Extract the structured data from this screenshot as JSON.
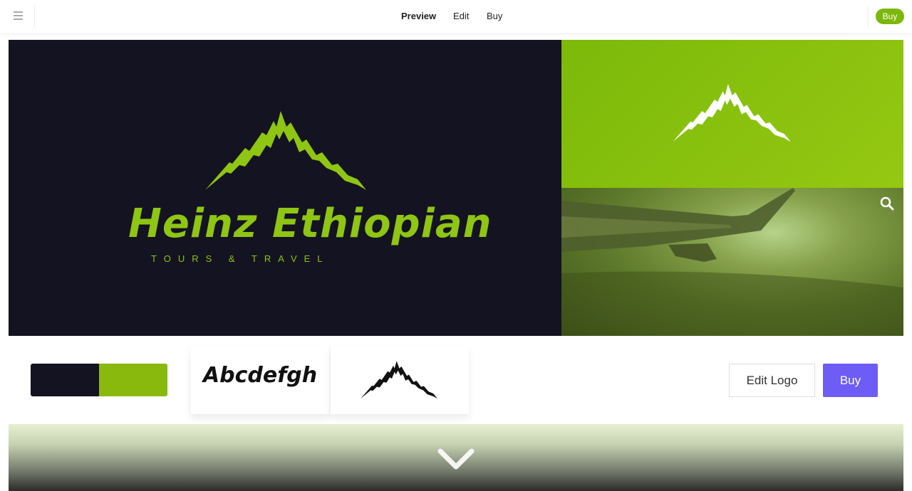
{
  "topbar": {
    "menu_icon": "hamburger-menu-icon",
    "nav": [
      "Preview",
      "Edit",
      "Buy"
    ],
    "active_tab": "Preview",
    "buy_label": "Buy",
    "buy_color": "#7cb809"
  },
  "hero": {
    "brand_name": "Heinz Ethiopian",
    "brand_tagline": "TOURS & TRAVEL",
    "brand_color": "#8fc513",
    "background": "#141321",
    "logo_icon": "mountain-icon",
    "zoom_icon": "search-icon"
  },
  "assets": {
    "palette": [
      "#141321",
      "#8ab90d"
    ],
    "font_sample": "Abcdefgh",
    "icon": "mountain-icon"
  },
  "actions": {
    "edit_label": "Edit Logo",
    "buy_label": "Buy",
    "buy_color": "#6e5cf6"
  },
  "scroll": {
    "icon": "chevron-down-icon"
  }
}
